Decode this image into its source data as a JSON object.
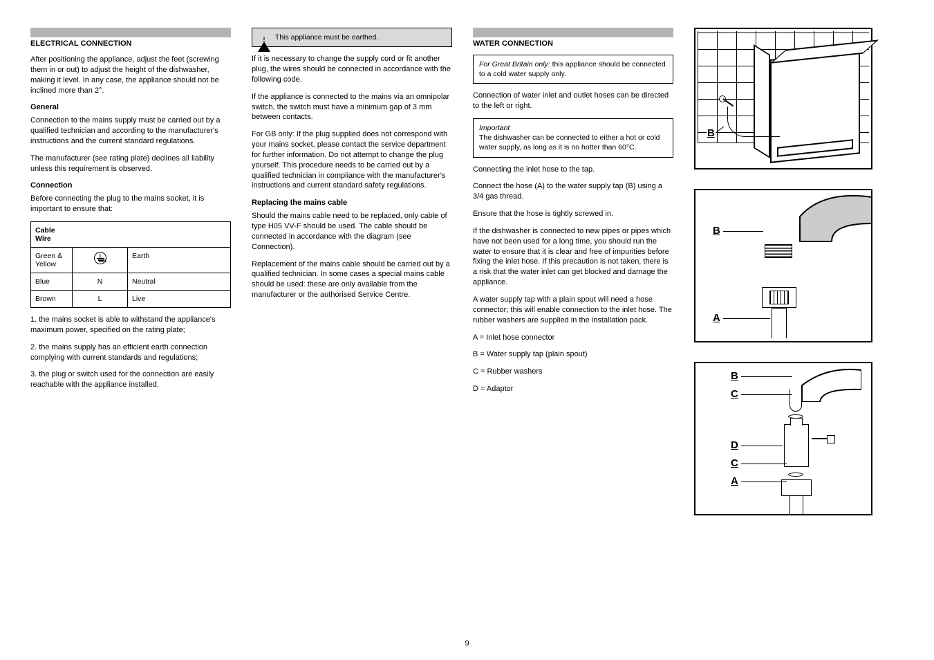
{
  "page_number": "9",
  "col1": {
    "title": "ELECTRICAL CONNECTION",
    "p1": "After positioning the appliance, adjust the feet (screwing them in or out) to adjust the height of the dishwasher, making it level. In any case, the appliance should not be inclined more than 2°.",
    "sub1": "General",
    "p2": "Connection to the mains supply must be carried out by a qualified technician and according to the manufacturer's instructions and the current standard regulations.",
    "p3": "The manufacturer (see rating plate) declines all liability unless this requirement is observed.",
    "sub2": "Connection",
    "p4": "Before connecting the plug to the mains socket, it is important to ensure that:",
    "li1": "1. the mains socket is able to withstand the appliance's maximum power, specified on the rating plate;",
    "li2": "2. the mains supply has an efficient earth connection complying with current standards and regulations;",
    "li3": "3. the plug or switch used for the connection are easily reachable with the appliance installed."
  },
  "wire_table": {
    "header": "Cable\nWire",
    "rows": [
      {
        "c1": "Green &\nYellow",
        "c2": "⏚",
        "c3": "Earth"
      },
      {
        "c1": "Blue",
        "c2": "N",
        "c3": "Neutral"
      },
      {
        "c1": "Brown",
        "c2": "L",
        "c3": "Live"
      }
    ]
  },
  "col2": {
    "warn": "This appliance must be earthed.",
    "p1": "If it is necessary to change the supply cord or fit another plug, the wires should be connected in accordance with the following code.",
    "p2": "If the appliance is connected to the mains via an omnipolar switch, the switch must have a minimum gap of 3 mm between contacts.",
    "p3": "For GB only: If the plug supplied does not correspond with your mains socket, please contact the service department for further information. Do not attempt to change the plug yourself. This procedure needs to be carried out by a qualified technician in compliance with the manufacturer's instructions and current standard safety regulations.",
    "sub1": "Replacing the mains cable",
    "p4": "Should the mains cable need to be replaced, only cable of type H05 VV-F should be used. The cable should be connected in accordance with the diagram (see Connection).",
    "p5": "Replacement of the mains cable should be carried out by a qualified technician. In some cases a special mains cable should be used: these are only available from the manufacturer or the authorised Service Centre."
  },
  "col3": {
    "title": "WATER CONNECTION",
    "box1_title": "For Great Britain only:",
    "box1_body": "this appliance should be connected to a cold water supply only.",
    "p1": "Connection of water inlet and outlet hoses can be directed to the left or right.",
    "box2_title": "Important",
    "box2_body": "The dishwasher can be connected to either a hot or cold water supply, as long as it is no hotter than 60°C.",
    "p2": "Connecting the inlet hose to the tap.",
    "p3": "Connect the hose (A) to the water supply tap (B) using a 3/4 gas thread.",
    "p4": "Ensure that the hose is tightly screwed in.",
    "p5": "If the dishwasher is connected to new pipes or pipes which have not been used for a long time, you should run the water to ensure that it is clear and free of impurities before fixing the inlet hose. If this precaution is not taken, there is a risk that the water inlet can get blocked and damage the appliance.",
    "p6": "A water supply tap with a plain spout will need a hose connector; this will enable connection to the inlet hose. The rubber washers are supplied in the installation pack.",
    "p7": "A = Inlet hose connector",
    "p8": "B = Water supply tap (plain spout)",
    "p9": "C = Rubber washers",
    "p10": "D = Adaptor"
  },
  "labels": {
    "A": "A",
    "B": "B",
    "C": "C",
    "D": "D"
  }
}
